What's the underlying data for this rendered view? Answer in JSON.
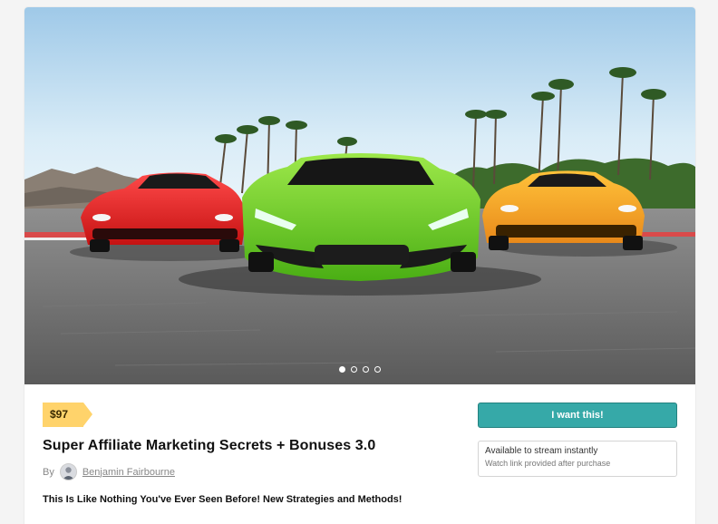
{
  "hero": {
    "image": "product-cover-three-sports-cars",
    "carousel": {
      "total": 4,
      "active": 1
    }
  },
  "product": {
    "price": "$97",
    "title": "Super Affiliate Marketing Secrets + Bonuses 3.0",
    "by_label": "By",
    "author": "Benjamin Fairbourne",
    "tagline": "This Is Like Nothing You've Ever Seen Before! New Strategies and Methods!"
  },
  "purchase": {
    "button_label": "I want this!",
    "availability": "Available to stream instantly",
    "availability_note": "Watch link provided after purchase"
  },
  "colors": {
    "accent": "#36a9a8",
    "price_badge": "#ffd36b"
  }
}
